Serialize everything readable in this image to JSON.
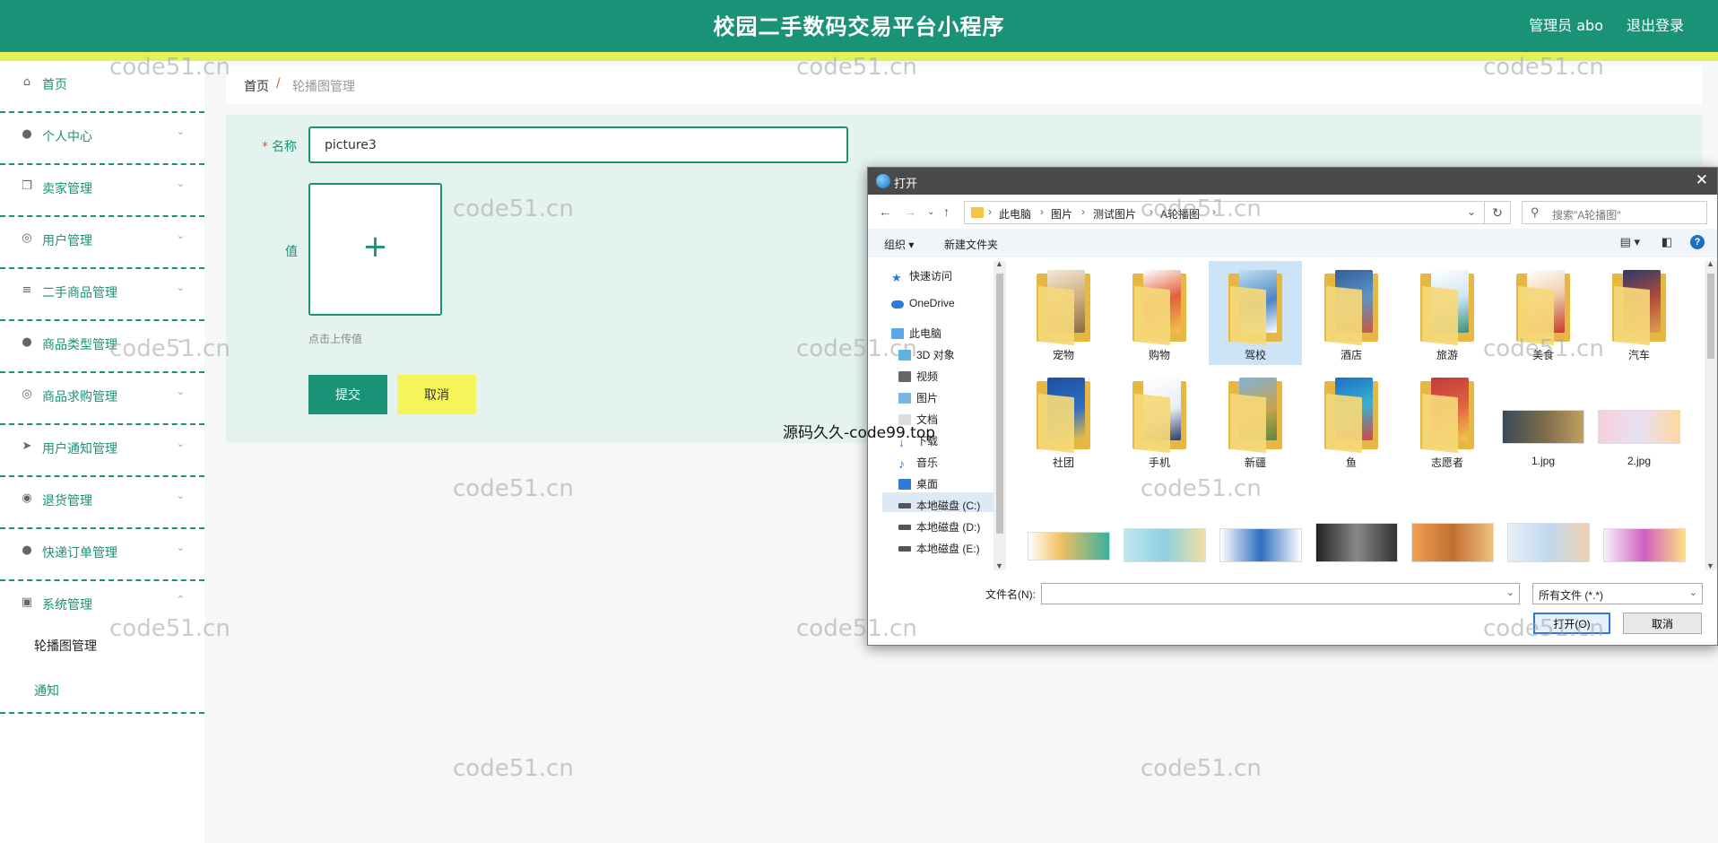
{
  "header": {
    "title": "校园二手数码交易平台小程序",
    "user": "管理员 abo",
    "logout": "退出登录"
  },
  "sidebar": {
    "items": [
      {
        "label": "首页",
        "icon": "home-icon",
        "expandable": false
      },
      {
        "label": "个人中心",
        "icon": "user-icon",
        "expandable": true
      },
      {
        "label": "卖家管理",
        "icon": "copy-icon",
        "expandable": true
      },
      {
        "label": "用户管理",
        "icon": "mic-icon",
        "expandable": true
      },
      {
        "label": "二手商品管理",
        "icon": "list-icon",
        "expandable": true
      },
      {
        "label": "商品类型管理",
        "icon": "user-icon",
        "expandable": true
      },
      {
        "label": "商品求购管理",
        "icon": "mic-icon",
        "expandable": true
      },
      {
        "label": "用户通知管理",
        "icon": "send-icon",
        "expandable": true
      },
      {
        "label": "退货管理",
        "icon": "target-icon",
        "expandable": true
      },
      {
        "label": "快递订单管理",
        "icon": "user-icon",
        "expandable": true
      },
      {
        "label": "系统管理",
        "icon": "monitor-icon",
        "expandable": true,
        "expanded": true
      }
    ],
    "sub_items": [
      {
        "label": "轮播图管理",
        "active": true
      },
      {
        "label": "通知",
        "active": false
      }
    ]
  },
  "breadcrumb": {
    "home": "首页",
    "separator": "/",
    "current": "轮播图管理"
  },
  "form": {
    "name_label": "名称",
    "required_mark": "*",
    "name_value": "picture3",
    "value_label": "值",
    "upload_hint": "点击上传值",
    "submit": "提交",
    "cancel": "取消"
  },
  "overlay_text": "源码久久-code99.top",
  "watermark": "code51.cn",
  "dialog": {
    "title": "打开",
    "path": [
      "此电脑",
      "图片",
      "测试图片",
      "A轮播图"
    ],
    "search_placeholder": "搜索\"A轮播图\"",
    "toolbar": {
      "organize": "组织 ▾",
      "new_folder": "新建文件夹"
    },
    "tree": [
      {
        "label": "快速访问",
        "icon": "star-icon"
      },
      {
        "label": "OneDrive",
        "icon": "cloud-icon"
      },
      {
        "label": "此电脑",
        "icon": "computer-icon"
      },
      {
        "label": "3D 对象",
        "icon": "cube-icon"
      },
      {
        "label": "视频",
        "icon": "video-icon"
      },
      {
        "label": "图片",
        "icon": "picture-icon",
        "selected": true
      },
      {
        "label": "文档",
        "icon": "document-icon"
      },
      {
        "label": "下载",
        "icon": "download-icon"
      },
      {
        "label": "音乐",
        "icon": "music-icon"
      },
      {
        "label": "桌面",
        "icon": "desktop-icon"
      },
      {
        "label": "本地磁盘 (C:)",
        "icon": "drive-icon"
      },
      {
        "label": "本地磁盘 (D:)",
        "icon": "drive-icon"
      },
      {
        "label": "本地磁盘 (E:)",
        "icon": "drive-icon"
      }
    ],
    "files_row1": [
      "宠物",
      "购物",
      "驾校",
      "酒店",
      "旅游",
      "美食",
      "汽车"
    ],
    "files_row2_folders": [
      "社团",
      "手机",
      "新疆",
      "鱼",
      "志愿者"
    ],
    "files_row2_images": [
      "1.jpg",
      "2.jpg"
    ],
    "selected_file": "驾校",
    "filename_label": "文件名(N):",
    "filename_value": "",
    "filter": "所有文件 (*.*)",
    "open_button": "打开(O)",
    "cancel_button": "取消"
  },
  "colors": {
    "primary": "#1a9277",
    "accent_yellow": "#f7f35a",
    "header_strip": "#e2f15a"
  }
}
